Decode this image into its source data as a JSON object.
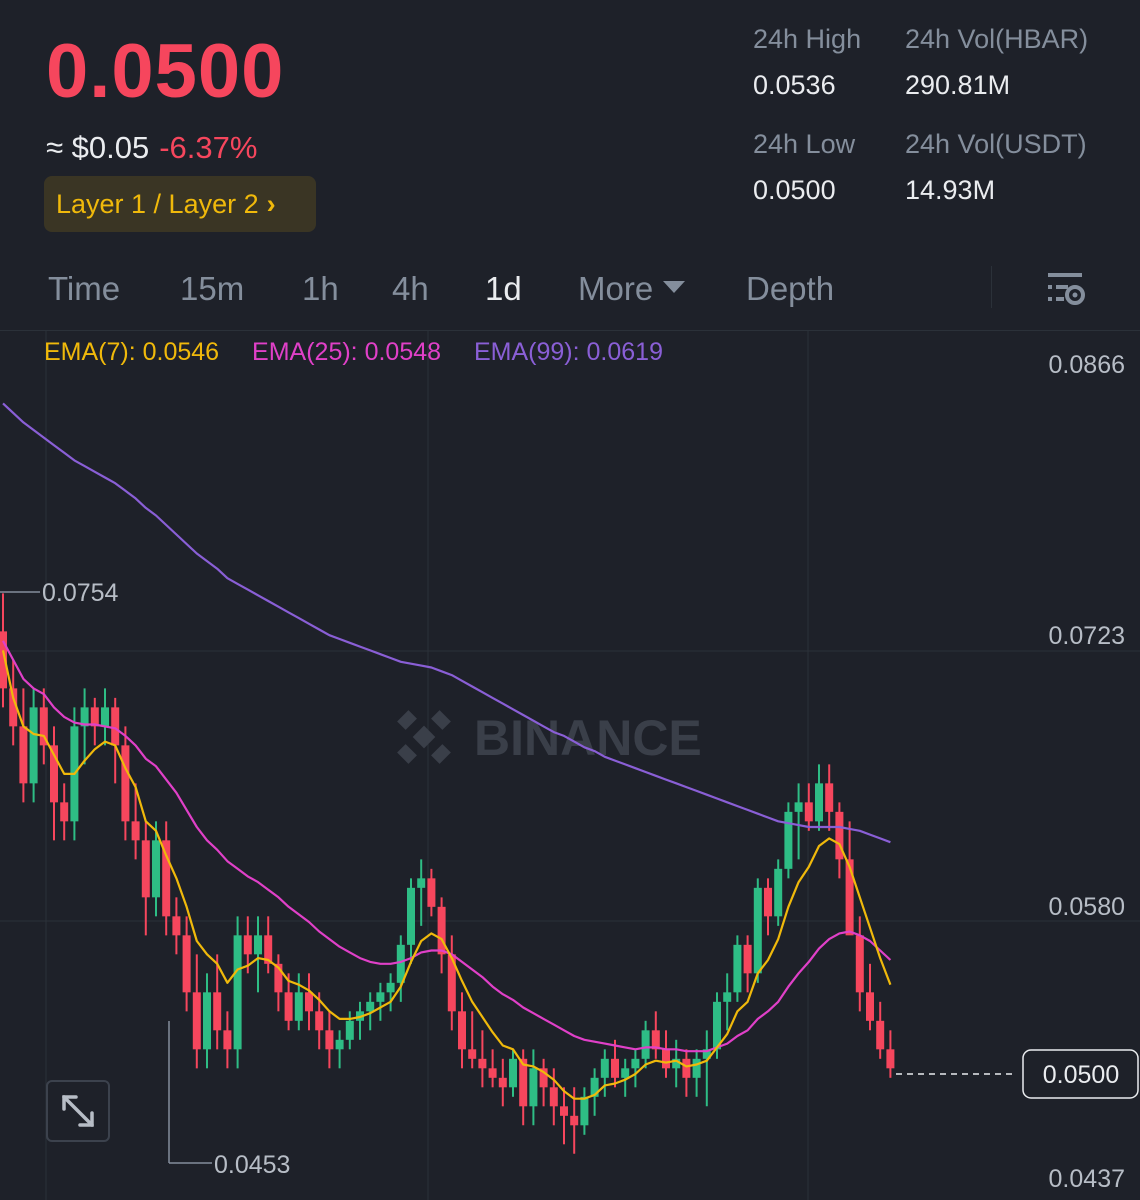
{
  "header": {
    "last_price": "0.0500",
    "usd_price": "≈ $0.05",
    "change_pct": "-6.37%",
    "tag": "Layer 1 / Layer 2",
    "tag_chevron": "›"
  },
  "stats": {
    "high_label": "24h High",
    "high_value": "0.0536",
    "vol_base_label": "24h Vol(HBAR)",
    "vol_base_value": "290.81M",
    "low_label": "24h Low",
    "low_value": "0.0500",
    "vol_quote_label": "24h Vol(USDT)",
    "vol_quote_value": "14.93M"
  },
  "tabs": {
    "time": "Time",
    "m15": "15m",
    "h1": "1h",
    "h4": "4h",
    "d1": "1d",
    "more": "More",
    "depth": "Depth",
    "active": "1d"
  },
  "watermark_text": "BINANCE",
  "colors": {
    "up": "#2ebd85",
    "down": "#f6465d",
    "ema7": "#f0b90b",
    "ema25": "#e040c8",
    "ema99": "#8a5fd6",
    "background": "#1e2129"
  },
  "chart_data": {
    "type": "candlestick",
    "ylim": [
      0.0437,
      0.0866
    ],
    "y_ticks": [
      "0.0866",
      "0.0723",
      "0.0580",
      "0.0437"
    ],
    "current_price_label": "0.0500",
    "max_marker": "0.0754",
    "min_marker": "0.0453",
    "legend": {
      "ema7": "EMA(7): 0.0546",
      "ema25": "EMA(25): 0.0548",
      "ema99": "EMA(99): 0.0619"
    },
    "candles": [
      [
        0.073,
        0.075,
        0.069,
        0.07
      ],
      [
        0.07,
        0.0715,
        0.067,
        0.068
      ],
      [
        0.068,
        0.07,
        0.064,
        0.065
      ],
      [
        0.065,
        0.07,
        0.064,
        0.069
      ],
      [
        0.069,
        0.07,
        0.066,
        0.067
      ],
      [
        0.067,
        0.068,
        0.062,
        0.064
      ],
      [
        0.064,
        0.065,
        0.062,
        0.063
      ],
      [
        0.063,
        0.069,
        0.062,
        0.068
      ],
      [
        0.068,
        0.07,
        0.066,
        0.069
      ],
      [
        0.069,
        0.0695,
        0.067,
        0.068
      ],
      [
        0.068,
        0.07,
        0.067,
        0.069
      ],
      [
        0.069,
        0.0695,
        0.065,
        0.067
      ],
      [
        0.067,
        0.068,
        0.062,
        0.063
      ],
      [
        0.063,
        0.065,
        0.061,
        0.062
      ],
      [
        0.062,
        0.063,
        0.057,
        0.059
      ],
      [
        0.059,
        0.063,
        0.058,
        0.062
      ],
      [
        0.062,
        0.063,
        0.057,
        0.058
      ],
      [
        0.058,
        0.059,
        0.056,
        0.057
      ],
      [
        0.057,
        0.058,
        0.053,
        0.054
      ],
      [
        0.054,
        0.056,
        0.05,
        0.051
      ],
      [
        0.051,
        0.055,
        0.05,
        0.054
      ],
      [
        0.054,
        0.056,
        0.051,
        0.052
      ],
      [
        0.052,
        0.053,
        0.05,
        0.051
      ],
      [
        0.051,
        0.058,
        0.05,
        0.057
      ],
      [
        0.057,
        0.058,
        0.055,
        0.056
      ],
      [
        0.056,
        0.058,
        0.054,
        0.057
      ],
      [
        0.057,
        0.058,
        0.055,
        0.0555
      ],
      [
        0.0555,
        0.056,
        0.053,
        0.054
      ],
      [
        0.054,
        0.055,
        0.052,
        0.0525
      ],
      [
        0.0525,
        0.055,
        0.052,
        0.054
      ],
      [
        0.054,
        0.055,
        0.052,
        0.053
      ],
      [
        0.053,
        0.054,
        0.051,
        0.052
      ],
      [
        0.052,
        0.053,
        0.05,
        0.051
      ],
      [
        0.051,
        0.052,
        0.05,
        0.0515
      ],
      [
        0.0515,
        0.053,
        0.051,
        0.0525
      ],
      [
        0.0525,
        0.0535,
        0.0515,
        0.053
      ],
      [
        0.053,
        0.054,
        0.052,
        0.0535
      ],
      [
        0.0535,
        0.0545,
        0.0525,
        0.054
      ],
      [
        0.054,
        0.055,
        0.053,
        0.0545
      ],
      [
        0.0545,
        0.057,
        0.0535,
        0.0565
      ],
      [
        0.0565,
        0.06,
        0.0555,
        0.0595
      ],
      [
        0.0595,
        0.061,
        0.0575,
        0.06
      ],
      [
        0.06,
        0.0605,
        0.058,
        0.0585
      ],
      [
        0.0585,
        0.059,
        0.055,
        0.056
      ],
      [
        0.056,
        0.057,
        0.052,
        0.053
      ],
      [
        0.053,
        0.054,
        0.05,
        0.051
      ],
      [
        0.051,
        0.053,
        0.05,
        0.0505
      ],
      [
        0.0505,
        0.052,
        0.049,
        0.05
      ],
      [
        0.05,
        0.051,
        0.049,
        0.0495
      ],
      [
        0.0495,
        0.0505,
        0.048,
        0.049
      ],
      [
        0.049,
        0.051,
        0.0485,
        0.0505
      ],
      [
        0.0505,
        0.051,
        0.047,
        0.048
      ],
      [
        0.048,
        0.051,
        0.047,
        0.05
      ],
      [
        0.05,
        0.0505,
        0.048,
        0.049
      ],
      [
        0.049,
        0.05,
        0.047,
        0.048
      ],
      [
        0.048,
        0.049,
        0.046,
        0.0475
      ],
      [
        0.0475,
        0.049,
        0.0455,
        0.047
      ],
      [
        0.047,
        0.049,
        0.0465,
        0.0485
      ],
      [
        0.0485,
        0.05,
        0.0475,
        0.0495
      ],
      [
        0.0495,
        0.051,
        0.0485,
        0.0505
      ],
      [
        0.0505,
        0.0515,
        0.049,
        0.0495
      ],
      [
        0.0495,
        0.0505,
        0.0485,
        0.05
      ],
      [
        0.05,
        0.051,
        0.049,
        0.0505
      ],
      [
        0.0505,
        0.0525,
        0.05,
        0.052
      ],
      [
        0.052,
        0.053,
        0.0505,
        0.051
      ],
      [
        0.051,
        0.052,
        0.0495,
        0.05
      ],
      [
        0.05,
        0.0515,
        0.049,
        0.0505
      ],
      [
        0.0505,
        0.051,
        0.0485,
        0.0495
      ],
      [
        0.0495,
        0.051,
        0.0485,
        0.0505
      ],
      [
        0.0505,
        0.052,
        0.048,
        0.051
      ],
      [
        0.051,
        0.054,
        0.0505,
        0.0535
      ],
      [
        0.0535,
        0.055,
        0.052,
        0.054
      ],
      [
        0.054,
        0.057,
        0.0535,
        0.0565
      ],
      [
        0.0565,
        0.057,
        0.054,
        0.055
      ],
      [
        0.055,
        0.06,
        0.0545,
        0.0595
      ],
      [
        0.0595,
        0.06,
        0.057,
        0.058
      ],
      [
        0.058,
        0.061,
        0.0575,
        0.0605
      ],
      [
        0.0605,
        0.064,
        0.06,
        0.0635
      ],
      [
        0.0635,
        0.065,
        0.061,
        0.064
      ],
      [
        0.064,
        0.065,
        0.0625,
        0.063
      ],
      [
        0.063,
        0.066,
        0.0625,
        0.065
      ],
      [
        0.065,
        0.066,
        0.0625,
        0.0635
      ],
      [
        0.0635,
        0.064,
        0.06,
        0.061
      ],
      [
        0.061,
        0.063,
        0.058,
        0.057
      ],
      [
        0.057,
        0.058,
        0.053,
        0.054
      ],
      [
        0.054,
        0.0555,
        0.052,
        0.0525
      ],
      [
        0.0525,
        0.0535,
        0.0505,
        0.051
      ],
      [
        0.051,
        0.052,
        0.0495,
        0.05
      ]
    ],
    "ema7": [
      0.072,
      0.0695,
      0.068,
      0.0676,
      0.0675,
      0.0665,
      0.0655,
      0.0655,
      0.0662,
      0.0668,
      0.0672,
      0.067,
      0.0658,
      0.0648,
      0.063,
      0.0625,
      0.0612,
      0.06,
      0.0585,
      0.0567,
      0.056,
      0.0555,
      0.0545,
      0.0552,
      0.0554,
      0.0558,
      0.0557,
      0.0553,
      0.0546,
      0.0544,
      0.0541,
      0.0536,
      0.053,
      0.0526,
      0.0526,
      0.0527,
      0.0529,
      0.0532,
      0.0535,
      0.0543,
      0.0556,
      0.0567,
      0.0571,
      0.0568,
      0.0558,
      0.0546,
      0.0535,
      0.0527,
      0.0519,
      0.0512,
      0.051,
      0.0502,
      0.0501,
      0.0498,
      0.0494,
      0.0488,
      0.0484,
      0.0484,
      0.0486,
      0.0491,
      0.0492,
      0.0494,
      0.0497,
      0.0502,
      0.0504,
      0.0503,
      0.0504,
      0.0501,
      0.0502,
      0.0504,
      0.0511,
      0.0518,
      0.053,
      0.0535,
      0.055,
      0.0557,
      0.0568,
      0.0585,
      0.0598,
      0.0606,
      0.0617,
      0.0621,
      0.0618,
      0.0606,
      0.059,
      0.0574,
      0.0558,
      0.0544
    ],
    "ema25": [
      0.0725,
      0.0715,
      0.0705,
      0.07,
      0.0697,
      0.069,
      0.0685,
      0.0682,
      0.0681,
      0.0681,
      0.068,
      0.0679,
      0.0675,
      0.067,
      0.0663,
      0.0659,
      0.0652,
      0.0645,
      0.0636,
      0.0627,
      0.062,
      0.0615,
      0.0609,
      0.0605,
      0.0601,
      0.0598,
      0.0594,
      0.059,
      0.0585,
      0.0581,
      0.0577,
      0.0572,
      0.0568,
      0.0564,
      0.0561,
      0.0558,
      0.0556,
      0.0555,
      0.0555,
      0.0556,
      0.0558,
      0.0561,
      0.0562,
      0.0562,
      0.056,
      0.0556,
      0.0552,
      0.0548,
      0.0543,
      0.0539,
      0.0536,
      0.0532,
      0.0529,
      0.0526,
      0.0523,
      0.052,
      0.0517,
      0.0515,
      0.0514,
      0.0513,
      0.0512,
      0.0511,
      0.051,
      0.0511,
      0.0511,
      0.051,
      0.051,
      0.0509,
      0.0509,
      0.0509,
      0.0511,
      0.0513,
      0.0517,
      0.052,
      0.0526,
      0.053,
      0.0535,
      0.0543,
      0.055,
      0.0556,
      0.0563,
      0.0568,
      0.0571,
      0.0572,
      0.057,
      0.0567,
      0.0562,
      0.0557
    ],
    "ema99": [
      0.085,
      0.0845,
      0.084,
      0.0836,
      0.0832,
      0.0828,
      0.0824,
      0.082,
      0.0817,
      0.0814,
      0.0811,
      0.0808,
      0.0804,
      0.08,
      0.0795,
      0.0791,
      0.0786,
      0.0781,
      0.0776,
      0.0771,
      0.0767,
      0.0763,
      0.0758,
      0.0755,
      0.0752,
      0.0749,
      0.0746,
      0.0743,
      0.074,
      0.0737,
      0.0734,
      0.0731,
      0.0728,
      0.0726,
      0.0724,
      0.0722,
      0.072,
      0.0718,
      0.0716,
      0.0714,
      0.0713,
      0.0712,
      0.0711,
      0.0709,
      0.0707,
      0.0704,
      0.0701,
      0.0698,
      0.0695,
      0.0692,
      0.0689,
      0.0686,
      0.0683,
      0.068,
      0.0677,
      0.0675,
      0.0672,
      0.0669,
      0.0667,
      0.0664,
      0.0662,
      0.066,
      0.0658,
      0.0656,
      0.0654,
      0.0652,
      0.065,
      0.0648,
      0.0646,
      0.0644,
      0.0642,
      0.064,
      0.0638,
      0.0636,
      0.0634,
      0.0632,
      0.063,
      0.0629,
      0.0628,
      0.0627,
      0.0627,
      0.0627,
      0.0627,
      0.0626,
      0.0625,
      0.0623,
      0.0621,
      0.0619
    ]
  }
}
